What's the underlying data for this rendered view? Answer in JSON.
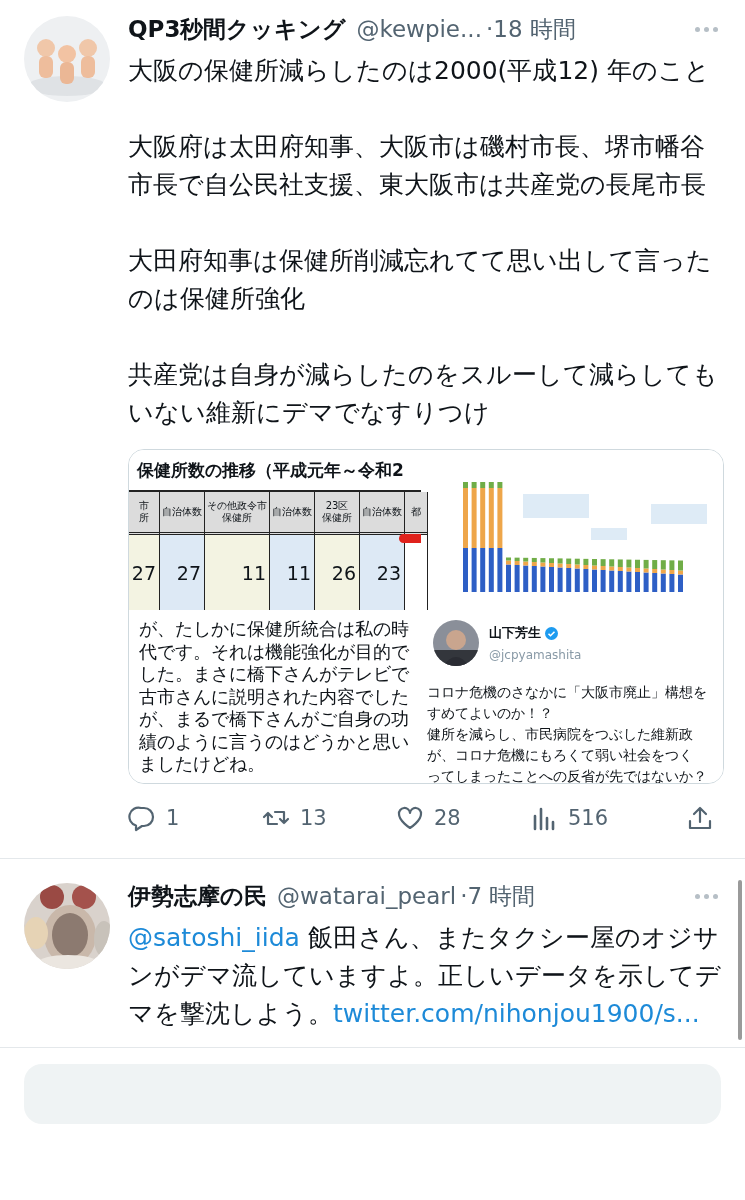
{
  "tweets": [
    {
      "author": "QP3秒間クッキング",
      "handle": "@kewpie...",
      "time": "·18 時間",
      "avatar": {
        "kind": "picture"
      },
      "paragraphs": [
        "大阪の保健所減らしたのは2000(平成12) 年のこと",
        "大阪府は太田府知事、大阪市は磯村市長、堺市幡谷市長で自公民社支援、東大阪市は共産党の長尾市長",
        "大田府知事は保健所削減忘れてて思い出して言ったのは保健所強化",
        "共産党は自身が減らしたのをスルーして減らしてもいない維新にデマでなすりつけ"
      ],
      "media": {
        "table": {
          "title": "保健所数の推移（平成元年～令和2",
          "columns": [
            {
              "header": [
                "市",
                "所"
              ],
              "value": "27"
            },
            {
              "header": [
                "自治体数"
              ],
              "value": "27"
            },
            {
              "header": [
                "その他政令市",
                "保健所"
              ],
              "value": "11"
            },
            {
              "header": [
                "自治体数"
              ],
              "value": "11"
            },
            {
              "header": [
                "23区",
                "保健所"
              ],
              "value": "26"
            },
            {
              "header": [
                "自治体数"
              ],
              "value": "23"
            },
            {
              "header": [
                "都"
              ]
            }
          ]
        },
        "chart": {
          "kind": "bars"
        },
        "quote": [
          "が、たしかに保健所統合は私の時",
          "代です。それは機能強化が目的で",
          "した。まさに橋下さんがテレビで",
          "古市さんに説明された内容でした",
          "が、まるで橋下さんがご自身の功",
          "績のように言うのはどうかと思い",
          "ましたけどね。"
        ],
        "embedded_tweet": {
          "author": "山下芳生",
          "verified": true,
          "handle": "@jcpyamashita",
          "lines": [
            "コロナ危機のさなかに「大阪市廃止」構想を",
            "すめてよいのか！？",
            "健所を減らし、市民病院をつぶした維新政",
            "が、コロナ危機にもろくて弱い社会をつく",
            "ってしまったことへの反省が先ではないか？"
          ]
        }
      },
      "actions": [
        {
          "kind": "reply",
          "count": "1"
        },
        {
          "kind": "retweet",
          "count": "13"
        },
        {
          "kind": "like",
          "count": "28"
        },
        {
          "kind": "views",
          "count": "516"
        },
        {
          "kind": "share"
        }
      ]
    },
    {
      "author": "伊勢志摩の民",
      "handle": "@watarai_pearl",
      "time": "·7 時間",
      "avatar": {
        "kind": "picture"
      },
      "segments": [
        {
          "kind": "mention",
          "text": "@satoshi_iida"
        },
        {
          "kind": "text",
          "text": " 飯田さん、またタクシー屋のオジサンがデマ流していますよ。正しいデータを示してデマを撃沈しよう。"
        },
        {
          "kind": "link",
          "text": "twitter.com/nihonjou1900/s..."
        }
      ]
    }
  ]
}
